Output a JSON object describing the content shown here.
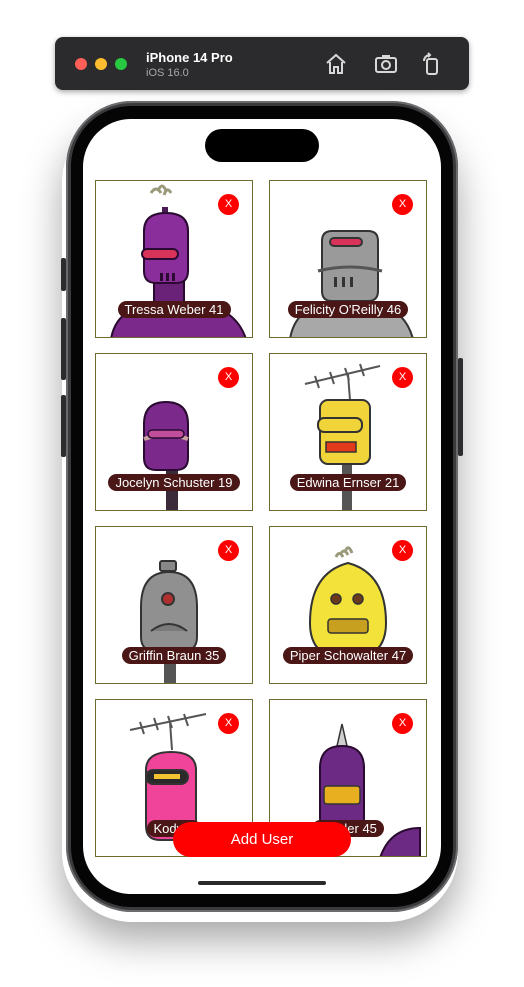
{
  "simulator": {
    "device_name": "iPhone 14 Pro",
    "os_version": "iOS 16.0",
    "icons": [
      "home-icon",
      "screenshot-icon",
      "rotate-icon"
    ]
  },
  "users": [
    {
      "name": "Tressa Weber 41",
      "robot_color": "#7b2a8c",
      "close_label": "X"
    },
    {
      "name": "Felicity O'Reilly 46",
      "robot_color": "#9a9a9a",
      "close_label": "X"
    },
    {
      "name": "Jocelyn Schuster 19",
      "robot_color": "#7b2a8c",
      "close_label": "X"
    },
    {
      "name": "Edwina Ernser 21",
      "robot_color": "#f0d43a",
      "close_label": "X"
    },
    {
      "name": "Griffin Braun 35",
      "robot_color": "#8f8f8f",
      "close_label": "X"
    },
    {
      "name": "Piper Schowalter 47",
      "robot_color": "#f2e23a",
      "close_label": "X"
    },
    {
      "name": "Kody T",
      "robot_color": "#f0449a",
      "close_label": "X"
    },
    {
      "name": "nfelder 45",
      "robot_color": "#6c2a85",
      "close_label": "X"
    }
  ],
  "add_button_label": "Add User",
  "colors": {
    "accent": "#ff0000",
    "label_background": "#4a1616",
    "card_border": "#6b6b2e"
  }
}
